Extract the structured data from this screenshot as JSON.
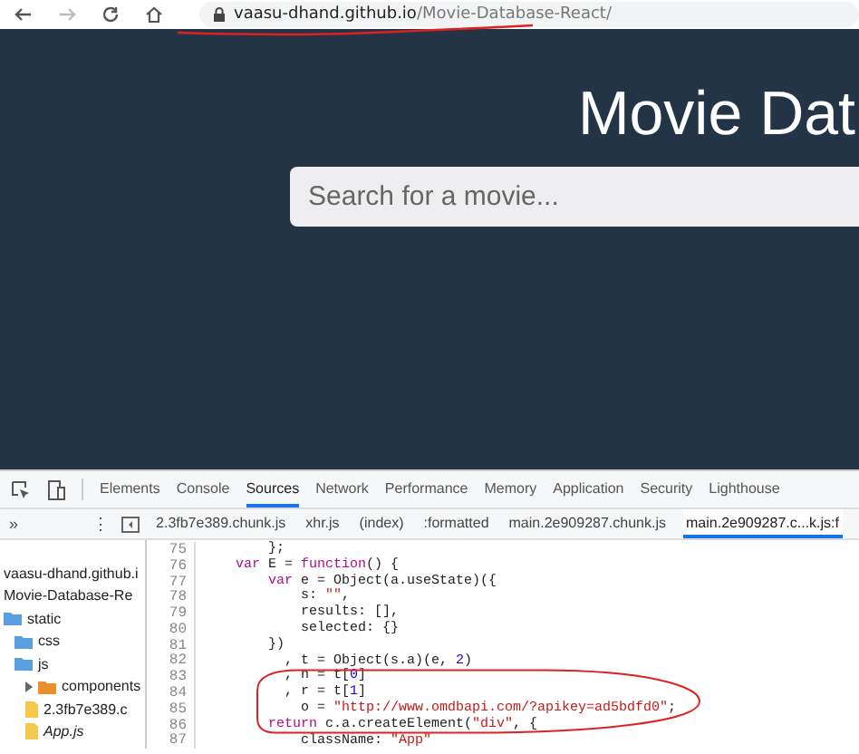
{
  "browser": {
    "url_host": "vaasu-dhand.github.io",
    "url_path": "/Movie-Database-React/"
  },
  "app": {
    "title": "Movie Dat",
    "search": {
      "placeholder": "Search for a movie..."
    }
  },
  "devtools": {
    "tabs": [
      {
        "label": "Elements",
        "selected": false
      },
      {
        "label": "Console",
        "selected": false
      },
      {
        "label": "Sources",
        "selected": true
      },
      {
        "label": "Network",
        "selected": false
      },
      {
        "label": "Performance",
        "selected": false
      },
      {
        "label": "Memory",
        "selected": false
      },
      {
        "label": "Application",
        "selected": false
      },
      {
        "label": "Security",
        "selected": false
      },
      {
        "label": "Lighthouse",
        "selected": false
      }
    ],
    "more_glyph": "»",
    "menu_glyph": "⋮",
    "file_tabs": [
      {
        "label": "2.3fb7e389.chunk.js",
        "selected": false
      },
      {
        "label": "xhr.js",
        "selected": false
      },
      {
        "label": "(index)",
        "selected": false
      },
      {
        "label": ":formatted",
        "selected": false
      },
      {
        "label": "main.2e909287.chunk.js",
        "selected": false
      },
      {
        "label": "main.2e909287.c...k.js:f",
        "selected": true
      }
    ],
    "tree": [
      {
        "label": "vaasu-dhand.github.i",
        "children": [
          {
            "label": "Movie-Database-Re",
            "children": [
              {
                "label": "static",
                "kind": "folder",
                "children": [
                  {
                    "label": "css",
                    "kind": "folder"
                  },
                  {
                    "label": "js",
                    "kind": "folder",
                    "children": [
                      {
                        "label": "components",
                        "kind": "module",
                        "expanded": false
                      },
                      {
                        "label": "2.3fb7e389.c",
                        "kind": "file"
                      },
                      {
                        "label": "App.js",
                        "kind": "file",
                        "italic": true
                      }
                    ]
                  }
                ]
              }
            ]
          }
        ]
      }
    ],
    "code": [
      {
        "number": "75",
        "tokens": [
          {
            "kind": "plain",
            "text": "        };"
          }
        ]
      },
      {
        "number": "76",
        "tokens": [
          {
            "kind": "keyword",
            "text": "    var"
          },
          {
            "kind": "plain",
            "text": " E = "
          },
          {
            "kind": "keyword",
            "text": "function"
          },
          {
            "kind": "plain",
            "text": "() {"
          }
        ]
      },
      {
        "number": "77",
        "tokens": [
          {
            "kind": "keyword",
            "text": "        var"
          },
          {
            "kind": "plain",
            "text": " e = Object(a.useState)({"
          }
        ]
      },
      {
        "number": "78",
        "tokens": [
          {
            "kind": "plain",
            "text": "            s: "
          },
          {
            "kind": "string",
            "text": "\"\""
          },
          {
            "kind": "plain",
            "text": ","
          }
        ]
      },
      {
        "number": "79",
        "tokens": [
          {
            "kind": "plain",
            "text": "            results: [],"
          }
        ]
      },
      {
        "number": "80",
        "tokens": [
          {
            "kind": "plain",
            "text": "            selected: {}"
          }
        ]
      },
      {
        "number": "81",
        "tokens": [
          {
            "kind": "plain",
            "text": "        })"
          }
        ]
      },
      {
        "number": "82",
        "tokens": [
          {
            "kind": "plain",
            "text": "          , t = Object(s.a)(e, "
          },
          {
            "kind": "number",
            "text": "2"
          },
          {
            "kind": "plain",
            "text": ")"
          }
        ]
      },
      {
        "number": "83",
        "tokens": [
          {
            "kind": "plain",
            "text": "          , n = t["
          },
          {
            "kind": "number",
            "text": "0"
          },
          {
            "kind": "plain",
            "text": "]"
          }
        ]
      },
      {
        "number": "84",
        "tokens": [
          {
            "kind": "plain",
            "text": "          , r = t["
          },
          {
            "kind": "number",
            "text": "1"
          },
          {
            "kind": "plain",
            "text": "]"
          }
        ]
      },
      {
        "number": "85",
        "tokens": [
          {
            "kind": "plain",
            "text": "            o = "
          },
          {
            "kind": "string",
            "text": "\"http://www.omdbapi.com/?apikey=ad5bdfd0\""
          },
          {
            "kind": "plain",
            "text": ";"
          }
        ]
      },
      {
        "number": "86",
        "tokens": [
          {
            "kind": "keyword",
            "text": "        return"
          },
          {
            "kind": "plain",
            "text": " c.a.createElement("
          },
          {
            "kind": "string",
            "text": "\"div\""
          },
          {
            "kind": "plain",
            "text": ", {"
          }
        ]
      },
      {
        "number": "87",
        "tokens": [
          {
            "kind": "plain",
            "text": "            className: "
          },
          {
            "kind": "string",
            "text": "\"App\""
          }
        ]
      }
    ]
  }
}
